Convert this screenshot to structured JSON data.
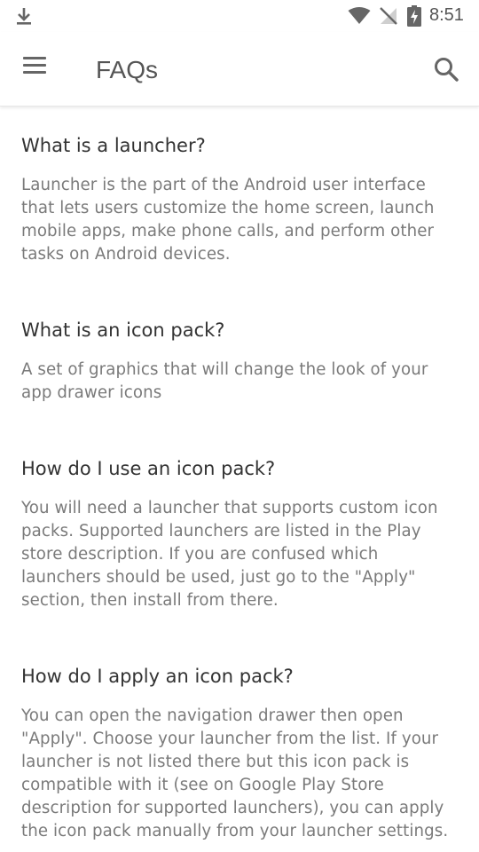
{
  "status_bar": {
    "time": "8:51",
    "icons": [
      "download-icon",
      "wifi-icon",
      "no-signal-icon",
      "battery-charging-icon"
    ]
  },
  "app_bar": {
    "title": "FAQs",
    "left_icon": "menu-icon",
    "right_icon": "search-icon"
  },
  "faqs": [
    {
      "question": "What is a launcher?",
      "answer": "Launcher is the part of the Android user interface that lets users customize the home screen, launch mobile apps, make phone calls, and perform other tasks on Android devices."
    },
    {
      "question": "What is an icon pack?",
      "answer": "A set of graphics that will change the look of your app drawer icons"
    },
    {
      "question": "How do I use an icon pack?",
      "answer": "You will need a launcher that supports custom icon packs. Supported launchers are listed in the Play store description. If you are confused which launchers should be used, just go to the \"Apply\" section, then install from there."
    },
    {
      "question": "How do I apply an icon pack?",
      "answer": "You can open the navigation drawer then open \"Apply\". Choose your launcher from the list. If your launcher is not listed there but this icon pack is compatible with it (see on Google Play Store description for supported launchers), you can apply the icon pack manually from your launcher settings."
    }
  ]
}
